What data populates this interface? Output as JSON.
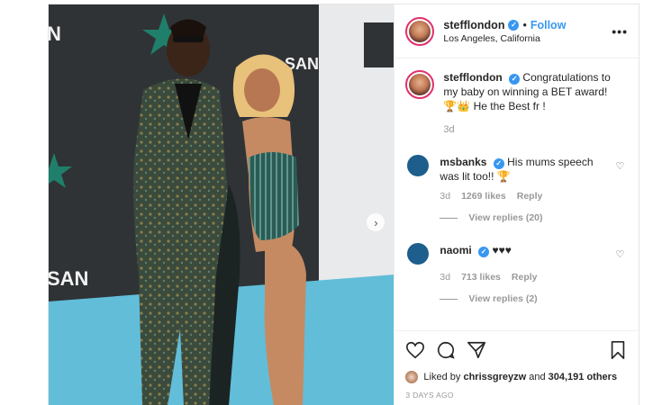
{
  "header": {
    "username": "stefflondon",
    "verified_icon": "verified-badge-icon",
    "separator": "•",
    "follow_label": "Follow",
    "location": "Los Angeles, California",
    "more_label": "•••"
  },
  "caption": {
    "username": "stefflondon",
    "text": "Congratulations to my baby on winning a BET award! 🏆👑 He the Best fr !",
    "time": "3d"
  },
  "comments": [
    {
      "username": "msbanks",
      "text": "His mums speech was lit too!! 🏆",
      "time": "3d",
      "likes": "1269 likes",
      "reply_label": "Reply",
      "view_replies": "View replies (20)"
    },
    {
      "username": "naomi",
      "text": "♥♥♥",
      "time": "3d",
      "likes": "713 likes",
      "reply_label": "Reply",
      "view_replies": "View replies (2)"
    }
  ],
  "footer": {
    "liked_prefix": "Liked by",
    "liked_user": "chrissgreyzw",
    "liked_and": "and",
    "liked_count": "304,191 others",
    "timestamp": "3 DAYS AGO"
  },
  "icons": {
    "heart": "heart-icon",
    "comment": "comment-icon",
    "share": "share-icon",
    "bookmark": "bookmark-icon",
    "next": "chevron-right-icon"
  },
  "colors": {
    "accent": "#3897f0",
    "floor": "#5bb8d6",
    "backdrop": "#2b2f33",
    "muted": "#999999"
  }
}
